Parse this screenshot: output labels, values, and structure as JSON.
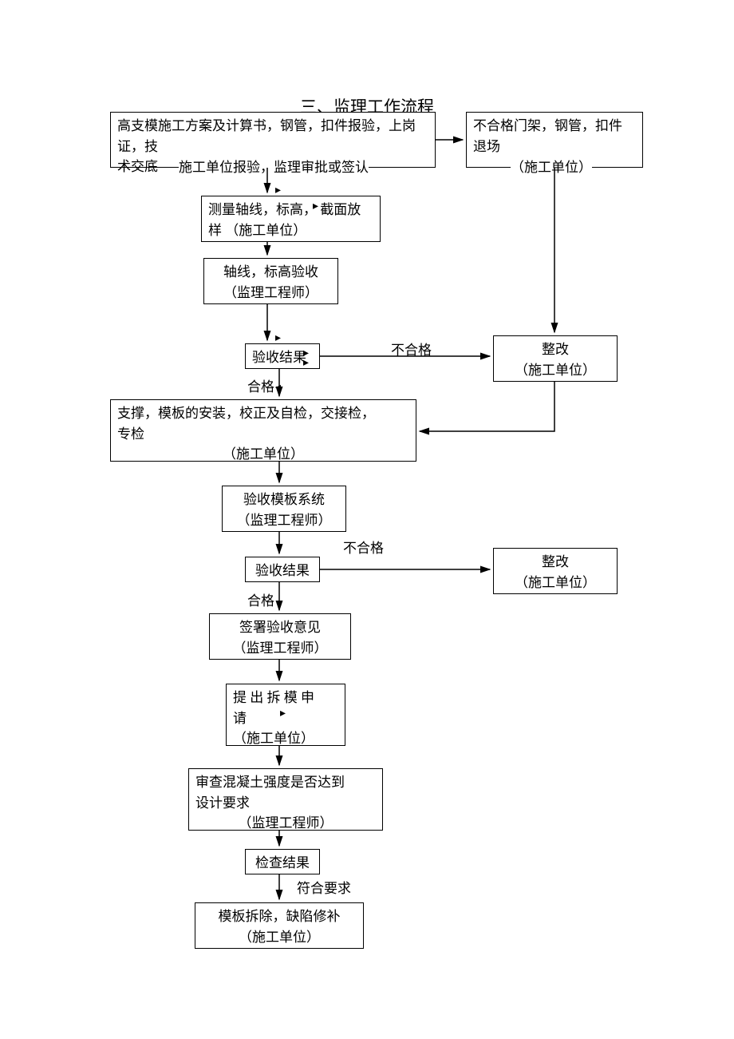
{
  "title": "三、监理工作流程",
  "boxes": {
    "b1": {
      "line1": "高支模施工方案及计算书，钢管，扣件报验，上岗证，技",
      "line2": "术交底",
      "sub": "施工单位报验，监理审批或签认"
    },
    "b2": {
      "line1": "不合格门架，钢管，扣件",
      "line2": "退场",
      "sub": "（施工单位）"
    },
    "b3": {
      "line1": "测量轴线，标高，  截面放",
      "line2": "样     （施工单位）"
    },
    "b4": {
      "line1": "轴线，标高验收",
      "line2": "（监理工程师）"
    },
    "b5": {
      "t": "验收结果"
    },
    "b6": {
      "line1": "整改",
      "line2": "（施工单位）"
    },
    "b7": {
      "line1": "支撑，模板的安装，校正及自检，交接检，",
      "line2": "专检",
      "sub": "（施工单位）"
    },
    "b8": {
      "line1": "验收模板系统",
      "line2": "（监理工程师）"
    },
    "b9": {
      "t": "验收结果"
    },
    "b10": {
      "line1": "整改",
      "line2": "（施工单位）"
    },
    "b11": {
      "line1": "签署验收意见",
      "line2": "（监理工程师）"
    },
    "b12": {
      "line1": "提 出 拆 模 申",
      "line2": "请",
      "sub": "（施工单位）"
    },
    "b13": {
      "line1": "审查混凝土强度是否达到",
      "line2": "设计要求",
      "sub": "（监理工程师）"
    },
    "b14": {
      "t": "检查结果"
    },
    "b15": {
      "line1": "模板拆除，缺陷修补",
      "line2": "（施工单位）"
    }
  },
  "labels": {
    "fail1": "不合格",
    "pass1": "合格",
    "fail2": "不合格",
    "pass2": "合格",
    "meets": "符合要求"
  }
}
